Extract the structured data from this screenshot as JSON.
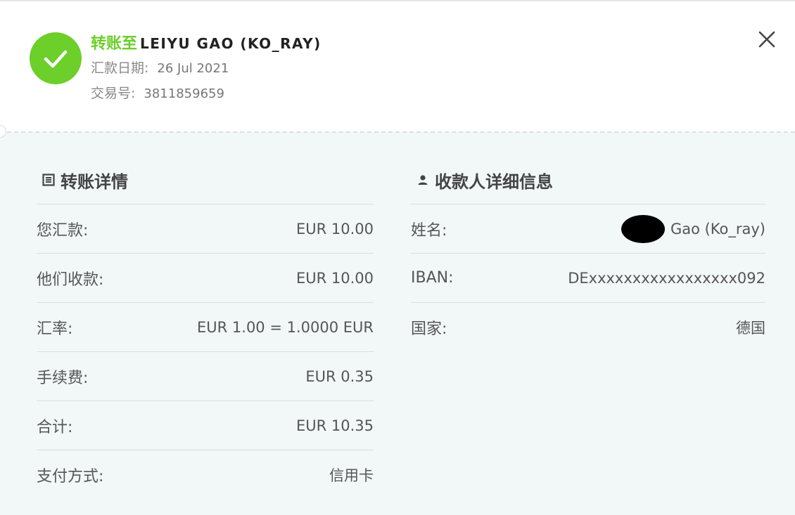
{
  "header": {
    "title_prefix": "转账至",
    "recipient_name": "LEIYU GAO (KO_RAY)",
    "date_label": "汇款日期:",
    "date_value": "26 Jul 2021",
    "txn_label": "交易号:",
    "txn_value": "3811859659"
  },
  "transfer": {
    "heading": "转账详情",
    "rows": [
      {
        "label": "您汇款:",
        "value": "EUR 10.00"
      },
      {
        "label": "他们收款:",
        "value": "EUR 10.00"
      },
      {
        "label": "汇率:",
        "value": "EUR 1.00 = 1.0000 EUR"
      },
      {
        "label": "手续费:",
        "value": "EUR 0.35"
      },
      {
        "label": "合计:",
        "value": "EUR 10.35"
      },
      {
        "label": "支付方式:",
        "value": "信用卡"
      }
    ]
  },
  "recipient": {
    "heading": "收款人详细信息",
    "rows": [
      {
        "label": "姓名:",
        "value": "Gao (Ko_ray)"
      },
      {
        "label": "IBAN:",
        "value": "DExxxxxxxxxxxxxxxxx092"
      },
      {
        "label": "国家:",
        "value": "德国"
      }
    ]
  },
  "icons": {
    "status": "check-circle-icon",
    "close": "close-icon",
    "transfer_heading": "document-list-icon",
    "recipient_heading": "person-icon"
  },
  "colors": {
    "accent_green": "#6ccf2a",
    "panel_bg": "#f2f8f8"
  }
}
